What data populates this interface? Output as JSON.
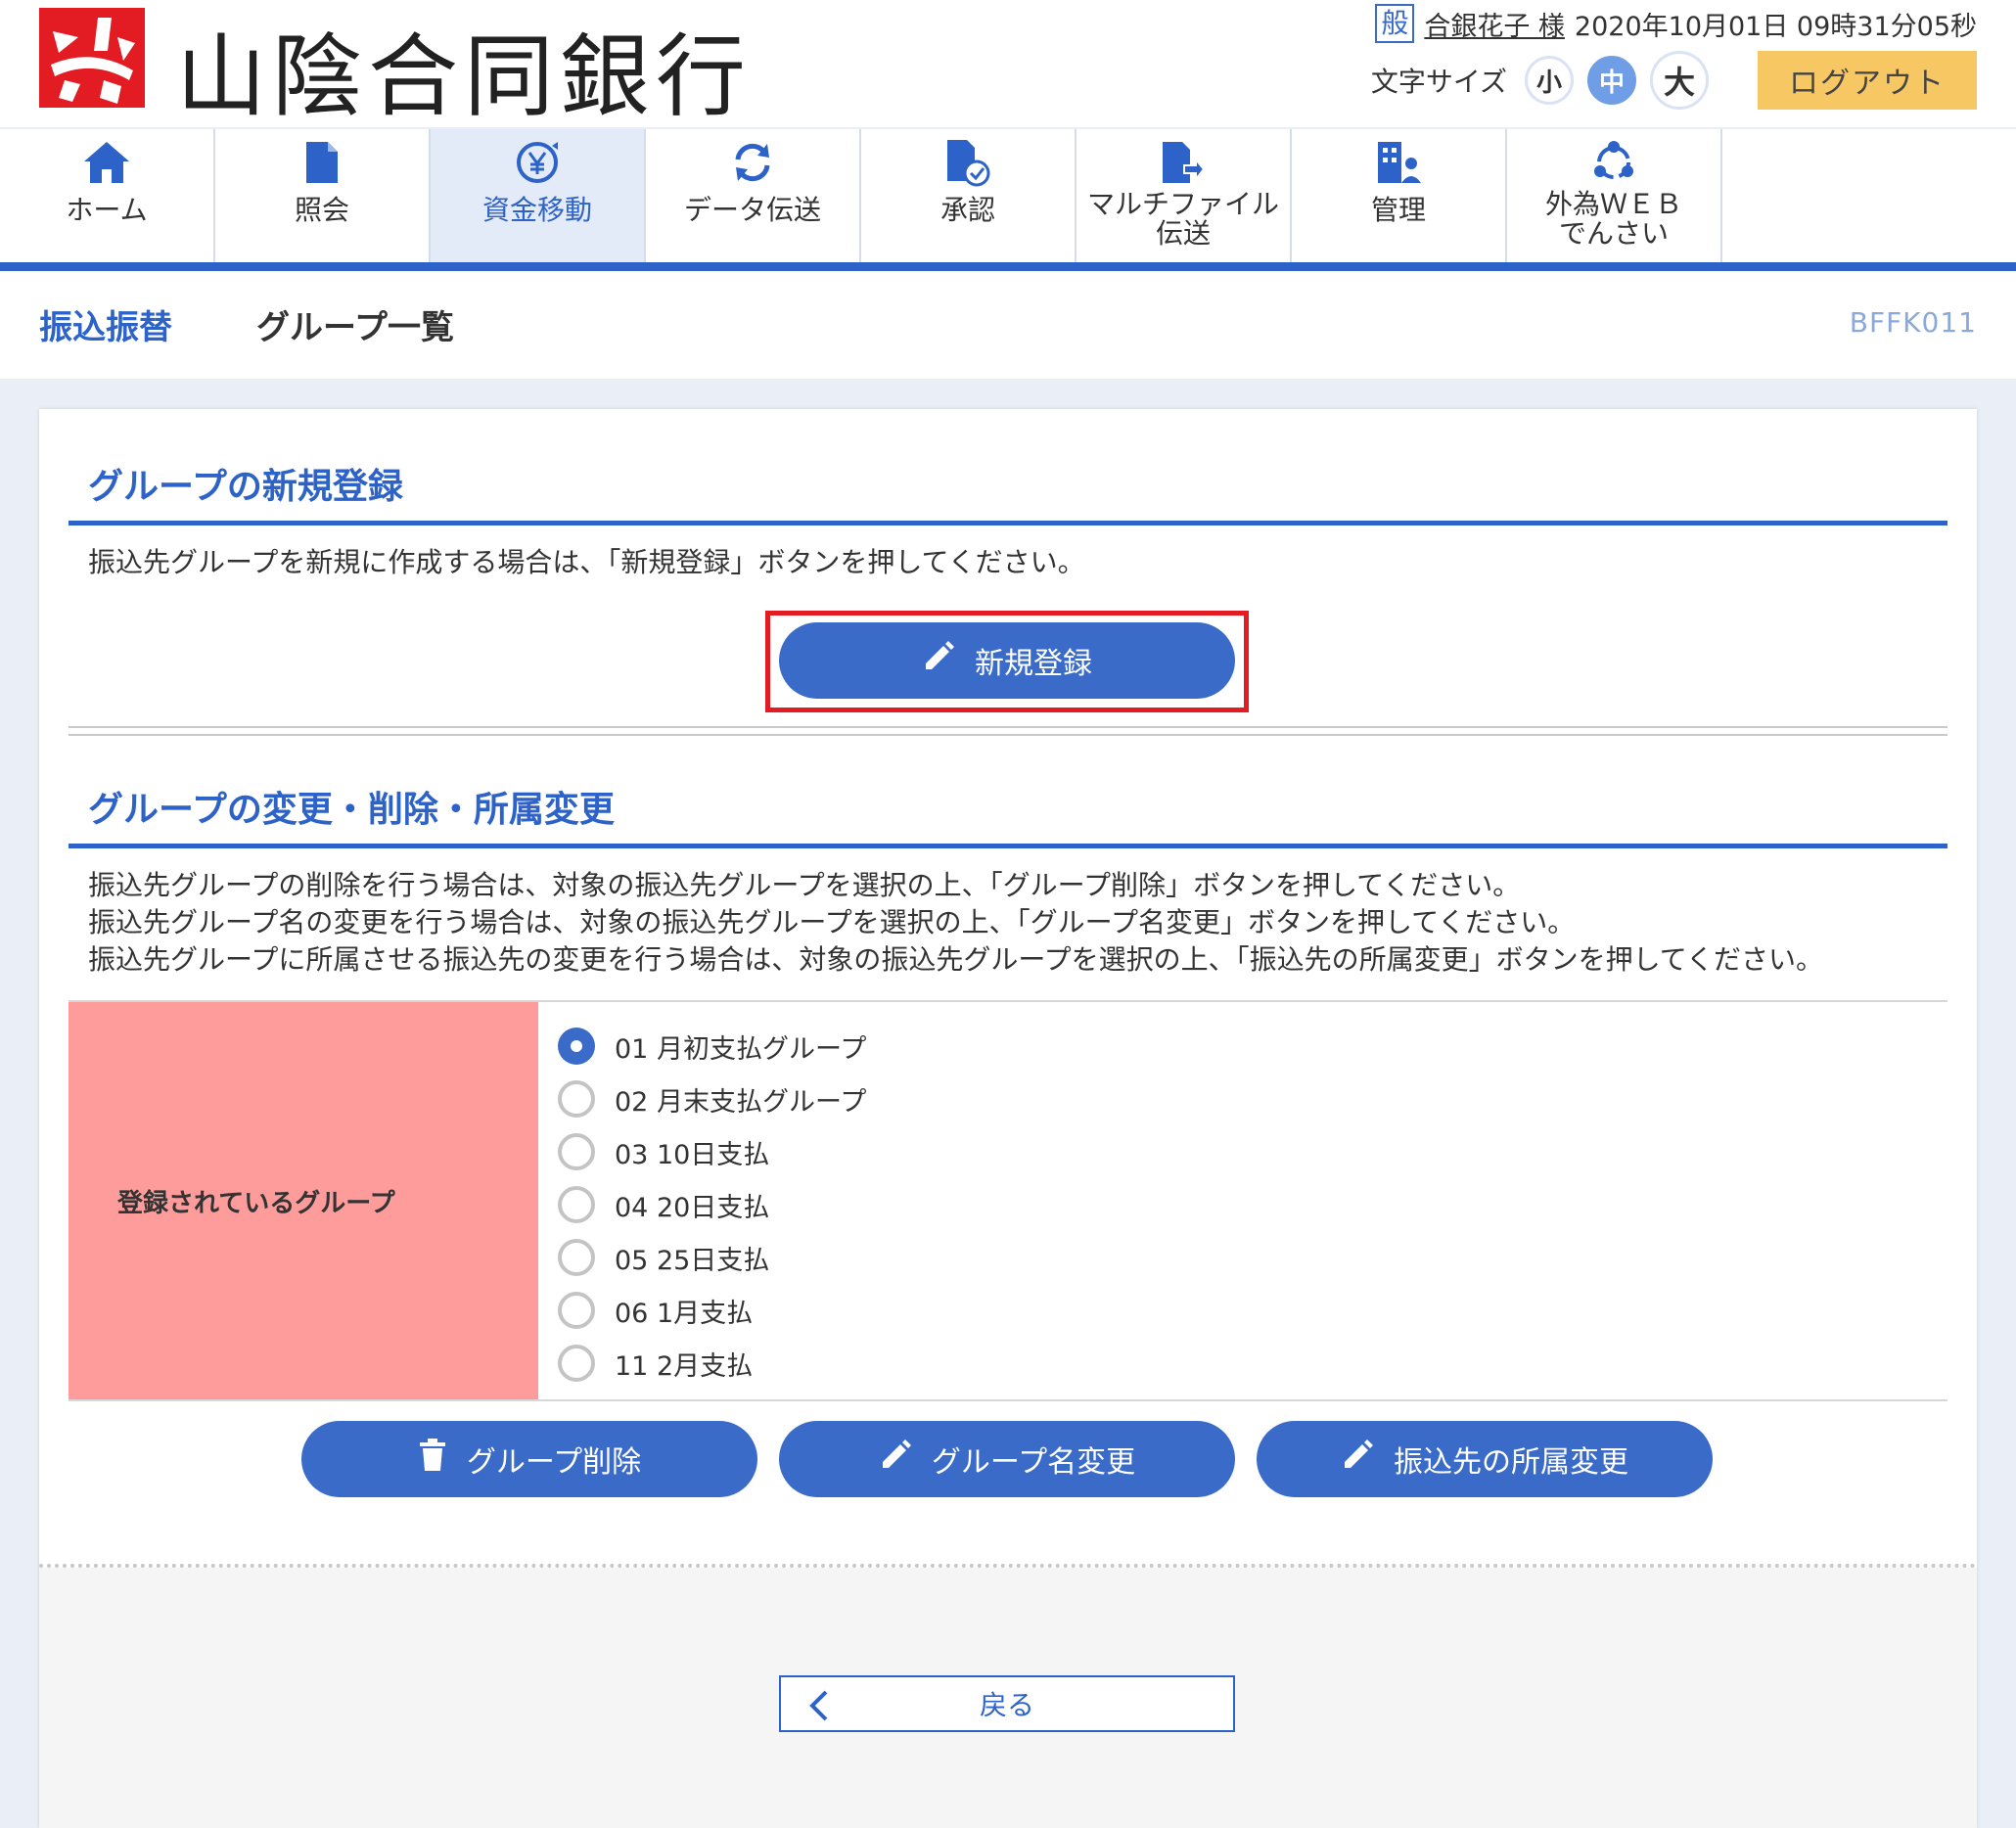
{
  "header": {
    "bank_name": "山陰合同銀行",
    "user_badge": "般",
    "user_name": "合銀花子 様",
    "datetime": "2020年10月01日 09時31分05秒",
    "font_size_label": "文字サイズ",
    "font_sizes": [
      "小",
      "中",
      "大"
    ],
    "font_size_selected": "中",
    "logout_label": "ログアウト"
  },
  "nav": {
    "items": [
      {
        "label": "ホーム",
        "icon": "home-icon"
      },
      {
        "label": "照会",
        "icon": "document-icon"
      },
      {
        "label": "資金移動",
        "icon": "yen-transfer-icon",
        "active": true
      },
      {
        "label": "データ伝送",
        "icon": "refresh-icon"
      },
      {
        "label": "承認",
        "icon": "document-check-icon"
      },
      {
        "label_line1": "マルチファイル",
        "label_line2": "伝送",
        "icon": "file-arrow-icon"
      },
      {
        "label": "管理",
        "icon": "building-person-icon"
      },
      {
        "label_line1": "外為ＷＥＢ",
        "label_line2": "でんさい",
        "icon": "circle-nodes-icon"
      }
    ]
  },
  "titlebar": {
    "section": "振込振替",
    "page": "グループ一覧",
    "code": "BFFK011"
  },
  "new_section": {
    "title": "グループの新規登録",
    "description": "振込先グループを新規に作成する場合は、「新規登録」ボタンを押してください。",
    "button_label": "新規登録"
  },
  "edit_section": {
    "title": "グループの変更・削除・所属変更",
    "descriptions": [
      "振込先グループの削除を行う場合は、対象の振込先グループを選択の上、「グループ削除」ボタンを押してください。",
      "振込先グループ名の変更を行う場合は、対象の振込先グループを選択の上、「グループ名変更」ボタンを押してください。",
      "振込先グループに所属させる振込先の変更を行う場合は、対象の振込先グループを選択の上、「振込先の所属変更」ボタンを押してください。"
    ],
    "table_header": "登録されているグループ",
    "groups": [
      {
        "label": "01 月初支払グループ",
        "checked": true
      },
      {
        "label": "02 月末支払グループ",
        "checked": false
      },
      {
        "label": "03 10日支払",
        "checked": false
      },
      {
        "label": "04 20日支払",
        "checked": false
      },
      {
        "label": "05 25日支払",
        "checked": false
      },
      {
        "label": "06 1月支払",
        "checked": false
      },
      {
        "label": "11 2月支払",
        "checked": false
      }
    ],
    "buttons": {
      "delete": "グループ削除",
      "rename": "グループ名変更",
      "membership": "振込先の所属変更"
    }
  },
  "footer": {
    "back_label": "戻る"
  },
  "colors": {
    "primary": "#3a6bc8",
    "nav_rule": "#2d62c8",
    "highlight": "#e31b23",
    "table_header_bg": "#fd9c9a",
    "logout_bg": "#f7c764"
  }
}
